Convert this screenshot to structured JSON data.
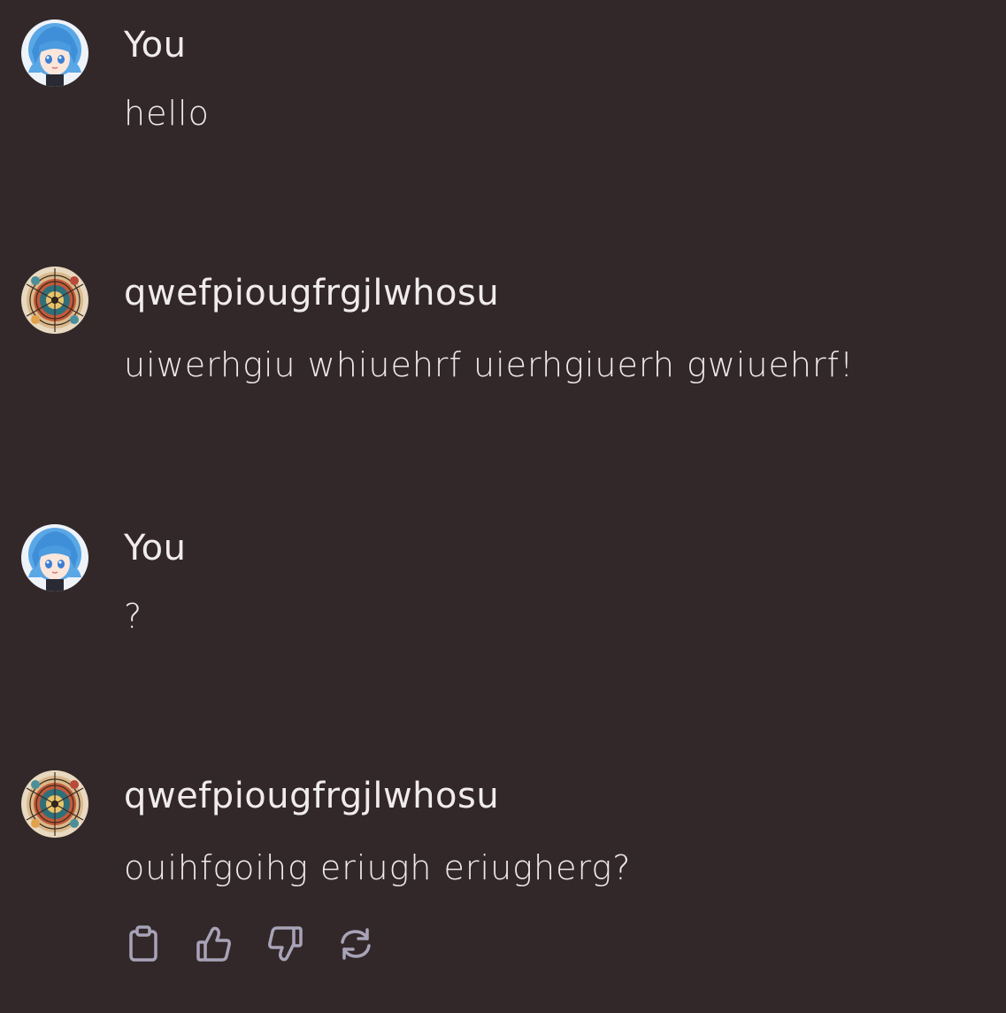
{
  "messages": [
    {
      "author": "You",
      "text": "hello",
      "avatar": "user-avatar"
    },
    {
      "author": "qwefpiougfrgjlwhosu",
      "text": "uiwerhgiu whiuehrf uierhgiuerh gwiuehrf!",
      "avatar": "bot-avatar"
    },
    {
      "author": "You",
      "text": "?",
      "avatar": "user-avatar"
    },
    {
      "author": "qwefpiougfrgjlwhosu",
      "text": "ouihfgoihg eriugh eriugherg?",
      "avatar": "bot-avatar"
    }
  ],
  "actions": [
    {
      "icon": "clipboard-icon"
    },
    {
      "icon": "thumbs-up-icon"
    },
    {
      "icon": "thumbs-down-icon"
    },
    {
      "icon": "regenerate-icon"
    }
  ],
  "colors": {
    "background": "#332829",
    "text": "#f0ecec",
    "icon": "#a8a3b8"
  }
}
